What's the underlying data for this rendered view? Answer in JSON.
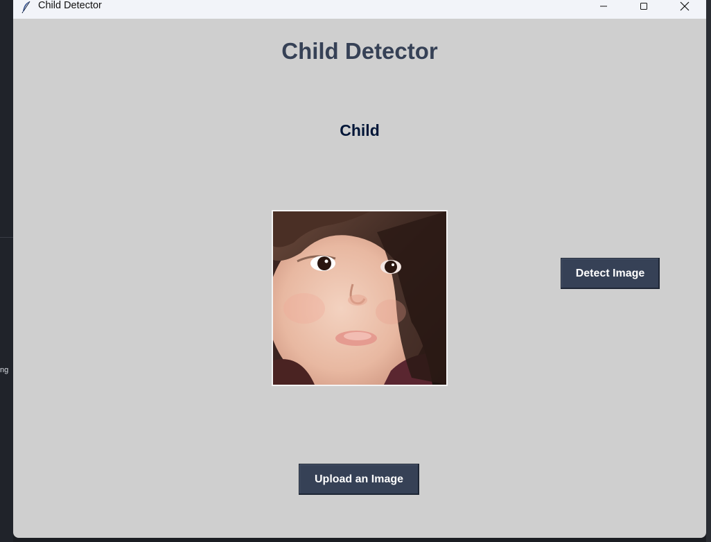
{
  "window": {
    "title": "Child Detector",
    "icon": "feather-icon",
    "controls": [
      "minimize-icon",
      "maximize-icon",
      "close-icon"
    ]
  },
  "main": {
    "heading": "Child Detector",
    "result_label": "Child",
    "detect_button": "Detect Image",
    "upload_button": "Upload an Image"
  },
  "background": {
    "left_edge_text": "ng"
  },
  "colors": {
    "window_bg": "#cfcfcf",
    "heading": "#364156",
    "result": "#011638",
    "button_bg": "#364156",
    "button_text": "#ffffff"
  }
}
